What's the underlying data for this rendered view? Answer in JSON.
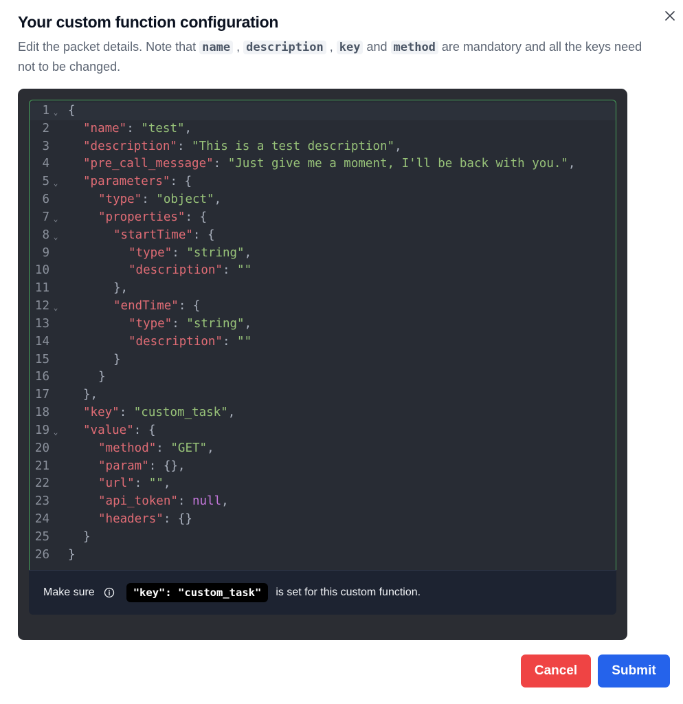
{
  "dialog": {
    "title": "Your custom function configuration",
    "description": {
      "prefix": "Edit the packet details. Note that ",
      "codes": [
        "name",
        "description",
        "key",
        "method"
      ],
      "sep1": " , ",
      "sep2": " , ",
      "and": " and ",
      "suffix": " are mandatory and all the keys need not to be changed."
    },
    "icons": {
      "close": "close-icon",
      "info": "info-icon",
      "fold": "chevron-down-icon"
    }
  },
  "editor": {
    "active_line": 1,
    "lines": [
      {
        "n": "1",
        "fold": true,
        "indent": 0,
        "tokens": [
          {
            "t": "p",
            "v": "{"
          }
        ]
      },
      {
        "n": "2",
        "fold": false,
        "indent": 1,
        "tokens": [
          {
            "t": "k",
            "v": "\"name\""
          },
          {
            "t": "p",
            "v": ": "
          },
          {
            "t": "s",
            "v": "\"test\""
          },
          {
            "t": "p",
            "v": ","
          }
        ]
      },
      {
        "n": "3",
        "fold": false,
        "indent": 1,
        "tokens": [
          {
            "t": "k",
            "v": "\"description\""
          },
          {
            "t": "p",
            "v": ": "
          },
          {
            "t": "s",
            "v": "\"This is a test description\""
          },
          {
            "t": "p",
            "v": ","
          }
        ]
      },
      {
        "n": "4",
        "fold": false,
        "indent": 1,
        "tokens": [
          {
            "t": "k",
            "v": "\"pre_call_message\""
          },
          {
            "t": "p",
            "v": ": "
          },
          {
            "t": "s",
            "v": "\"Just give me a moment, I'll be back with you.\""
          },
          {
            "t": "p",
            "v": ","
          }
        ]
      },
      {
        "n": "5",
        "fold": true,
        "indent": 1,
        "tokens": [
          {
            "t": "k",
            "v": "\"parameters\""
          },
          {
            "t": "p",
            "v": ": {"
          }
        ]
      },
      {
        "n": "6",
        "fold": false,
        "indent": 2,
        "tokens": [
          {
            "t": "k",
            "v": "\"type\""
          },
          {
            "t": "p",
            "v": ": "
          },
          {
            "t": "s",
            "v": "\"object\""
          },
          {
            "t": "p",
            "v": ","
          }
        ]
      },
      {
        "n": "7",
        "fold": true,
        "indent": 2,
        "tokens": [
          {
            "t": "k",
            "v": "\"properties\""
          },
          {
            "t": "p",
            "v": ": {"
          }
        ]
      },
      {
        "n": "8",
        "fold": true,
        "indent": 3,
        "tokens": [
          {
            "t": "k",
            "v": "\"startTime\""
          },
          {
            "t": "p",
            "v": ": {"
          }
        ]
      },
      {
        "n": "9",
        "fold": false,
        "indent": 4,
        "tokens": [
          {
            "t": "k",
            "v": "\"type\""
          },
          {
            "t": "p",
            "v": ": "
          },
          {
            "t": "s",
            "v": "\"string\""
          },
          {
            "t": "p",
            "v": ","
          }
        ]
      },
      {
        "n": "10",
        "fold": false,
        "indent": 4,
        "tokens": [
          {
            "t": "k",
            "v": "\"description\""
          },
          {
            "t": "p",
            "v": ": "
          },
          {
            "t": "s",
            "v": "\"\""
          }
        ]
      },
      {
        "n": "11",
        "fold": false,
        "indent": 3,
        "tokens": [
          {
            "t": "p",
            "v": "},"
          }
        ]
      },
      {
        "n": "12",
        "fold": true,
        "indent": 3,
        "tokens": [
          {
            "t": "k",
            "v": "\"endTime\""
          },
          {
            "t": "p",
            "v": ": {"
          }
        ]
      },
      {
        "n": "13",
        "fold": false,
        "indent": 4,
        "tokens": [
          {
            "t": "k",
            "v": "\"type\""
          },
          {
            "t": "p",
            "v": ": "
          },
          {
            "t": "s",
            "v": "\"string\""
          },
          {
            "t": "p",
            "v": ","
          }
        ]
      },
      {
        "n": "14",
        "fold": false,
        "indent": 4,
        "tokens": [
          {
            "t": "k",
            "v": "\"description\""
          },
          {
            "t": "p",
            "v": ": "
          },
          {
            "t": "s",
            "v": "\"\""
          }
        ]
      },
      {
        "n": "15",
        "fold": false,
        "indent": 3,
        "tokens": [
          {
            "t": "p",
            "v": "}"
          }
        ]
      },
      {
        "n": "16",
        "fold": false,
        "indent": 2,
        "tokens": [
          {
            "t": "p",
            "v": "}"
          }
        ]
      },
      {
        "n": "17",
        "fold": false,
        "indent": 1,
        "tokens": [
          {
            "t": "p",
            "v": "},"
          }
        ]
      },
      {
        "n": "18",
        "fold": false,
        "indent": 1,
        "tokens": [
          {
            "t": "k",
            "v": "\"key\""
          },
          {
            "t": "p",
            "v": ": "
          },
          {
            "t": "s",
            "v": "\"custom_task\""
          },
          {
            "t": "p",
            "v": ","
          }
        ]
      },
      {
        "n": "19",
        "fold": true,
        "indent": 1,
        "tokens": [
          {
            "t": "k",
            "v": "\"value\""
          },
          {
            "t": "p",
            "v": ": {"
          }
        ]
      },
      {
        "n": "20",
        "fold": false,
        "indent": 2,
        "tokens": [
          {
            "t": "k",
            "v": "\"method\""
          },
          {
            "t": "p",
            "v": ": "
          },
          {
            "t": "s",
            "v": "\"GET\""
          },
          {
            "t": "p",
            "v": ","
          }
        ]
      },
      {
        "n": "21",
        "fold": false,
        "indent": 2,
        "tokens": [
          {
            "t": "k",
            "v": "\"param\""
          },
          {
            "t": "p",
            "v": ": {},"
          }
        ]
      },
      {
        "n": "22",
        "fold": false,
        "indent": 2,
        "tokens": [
          {
            "t": "k",
            "v": "\"url\""
          },
          {
            "t": "p",
            "v": ": "
          },
          {
            "t": "s",
            "v": "\"\""
          },
          {
            "t": "p",
            "v": ","
          }
        ]
      },
      {
        "n": "23",
        "fold": false,
        "indent": 2,
        "tokens": [
          {
            "t": "k",
            "v": "\"api_token\""
          },
          {
            "t": "p",
            "v": ": "
          },
          {
            "t": "n",
            "v": "null"
          },
          {
            "t": "p",
            "v": ","
          }
        ]
      },
      {
        "n": "24",
        "fold": false,
        "indent": 2,
        "tokens": [
          {
            "t": "k",
            "v": "\"headers\""
          },
          {
            "t": "p",
            "v": ": {}"
          }
        ]
      },
      {
        "n": "25",
        "fold": false,
        "indent": 1,
        "tokens": [
          {
            "t": "p",
            "v": "}"
          }
        ]
      },
      {
        "n": "26",
        "fold": false,
        "indent": 0,
        "tokens": [
          {
            "t": "p",
            "v": "}"
          }
        ]
      }
    ],
    "colors": {
      "key": "#e06c75",
      "string": "#98c379",
      "null": "#c678dd",
      "punct": "#abb2bf",
      "border": "#46a35a"
    }
  },
  "footer": {
    "make_sure": "Make sure",
    "key_badge": "\"key\": \"custom_task\"",
    "suffix": "is set for this custom function."
  },
  "buttons": {
    "cancel": "Cancel",
    "submit": "Submit",
    "cancel_color": "#ef4444",
    "submit_color": "#2563eb"
  }
}
